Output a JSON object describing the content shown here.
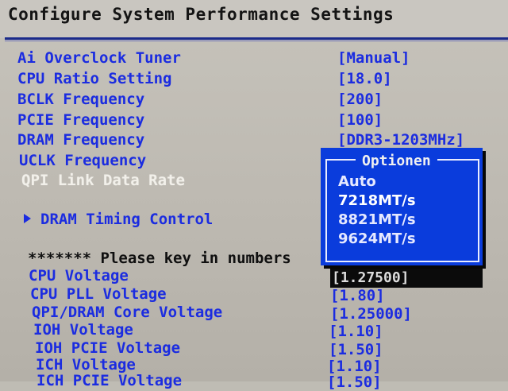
{
  "header": {
    "title": "Configure System Performance Settings"
  },
  "settings": [
    {
      "label": "Ai Overclock Tuner",
      "value": "[Manual]"
    },
    {
      "label": "CPU Ratio Setting",
      "value": "[18.0]"
    },
    {
      "label": "BCLK Frequency",
      "value": "[200]"
    },
    {
      "label": "PCIE Frequency",
      "value": "[100]"
    },
    {
      "label": "DRAM Frequency",
      "value": "[DDR3-1203MHz]"
    },
    {
      "label": "UCLK Frequency",
      "value": ""
    },
    {
      "label": "QPI Link Data Rate",
      "value": ""
    }
  ],
  "submenu": {
    "label": "DRAM Timing Control"
  },
  "hint": "******* Please key in numbers",
  "voltages": [
    {
      "label": "CPU Voltage",
      "value": "[1.27500]"
    },
    {
      "label": "CPU PLL Voltage",
      "value": "[1.80]"
    },
    {
      "label": "QPI/DRAM Core Voltage",
      "value": "[1.25000]"
    },
    {
      "label": "IOH Voltage",
      "value": "[1.10]"
    },
    {
      "label": "IOH PCIE Voltage",
      "value": "[1.50]"
    },
    {
      "label": "ICH Voltage",
      "value": "[1.10]"
    },
    {
      "label": "ICH PCIE Voltage",
      "value": "[1.50]"
    }
  ],
  "popup": {
    "title": "Optionen",
    "options": [
      "Auto",
      "7218MT/s",
      "8821MT/s",
      "9624MT/s"
    ]
  },
  "colors": {
    "label_blue": "#1b2ce0",
    "popup_blue": "#0a3cdc",
    "highlight_text": "#f2f0ea",
    "selection_bar": "#0b0b0b"
  }
}
